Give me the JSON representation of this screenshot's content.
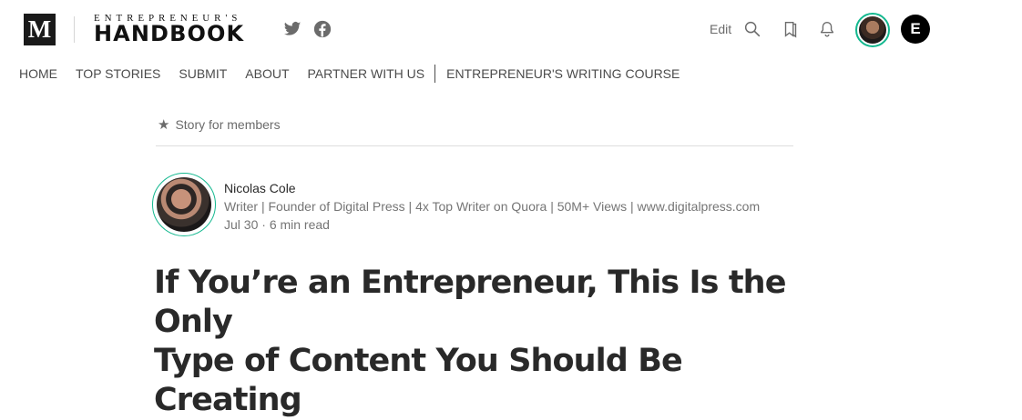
{
  "header": {
    "site_logo_letter": "M",
    "publication": {
      "top_text": "ENTREPRENEUR'S",
      "main_text": "HANDBOOK"
    },
    "social_icons": [
      "twitter-icon",
      "facebook-icon"
    ],
    "edit_label": "Edit",
    "action_icons": [
      "search-icon",
      "bookmarks-icon",
      "bell-icon"
    ],
    "account_badge_letter": "E",
    "accent_color": "#14b88f"
  },
  "nav": {
    "items": [
      "HOME",
      "TOP STORIES",
      "SUBMIT",
      "ABOUT",
      "PARTNER WITH US"
    ],
    "after_separator": [
      "ENTREPRENEUR'S WRITING COURSE"
    ]
  },
  "article": {
    "members_label": "Story for members",
    "author": {
      "name": "Nicolas Cole",
      "bio": "Writer | Founder of Digital Press | 4x Top Writer on Quora | 50M+ Views | www.digitalpress.com",
      "date": "Jul 30",
      "read_time": "6 min read"
    },
    "title_line1": "If You’re an Entrepreneur, This Is the Only",
    "title_line2": "Type of Content You Should Be Creating"
  }
}
